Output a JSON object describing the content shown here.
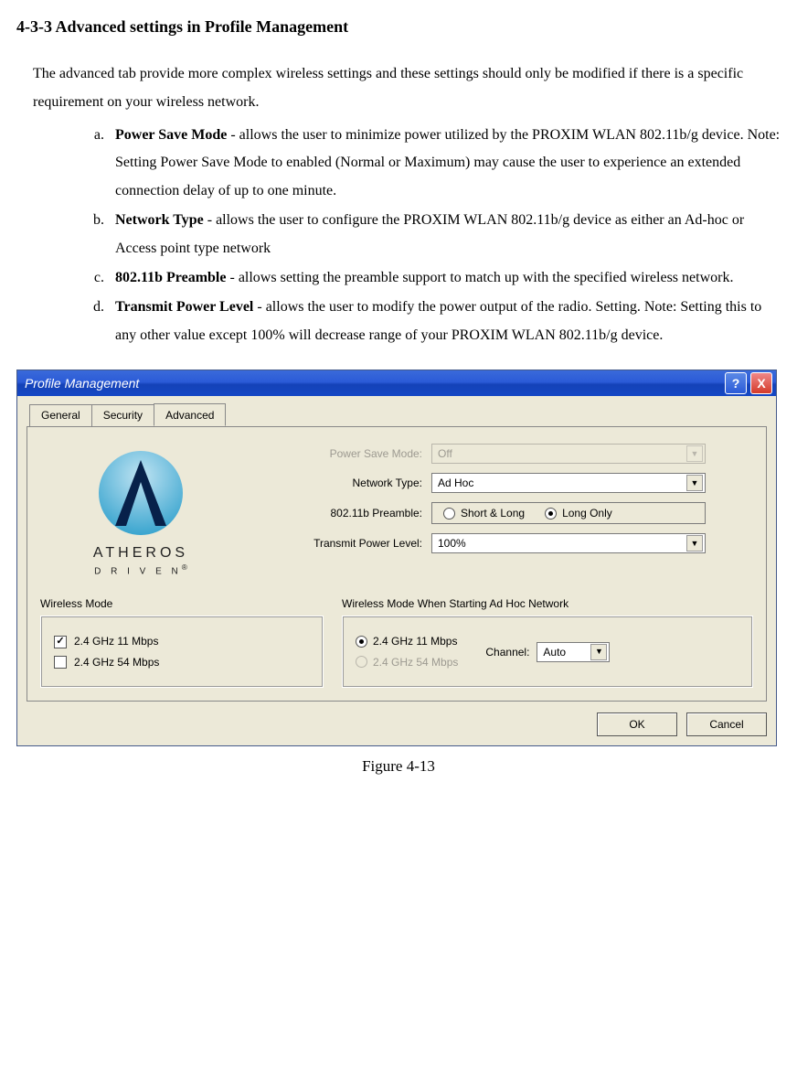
{
  "heading": "4-3-3 Advanced settings in Profile Management",
  "intro": "The advanced tab provide more complex wireless settings and these settings should only be modified if there is a specific requirement on your wireless network.",
  "items": {
    "a": {
      "bold": "Power Save Mode",
      "rest": " - allows the user to minimize power utilized by the PROXIM WLAN 802.11b/g  device.  Note: Setting Power Save Mode to enabled (Normal or Maximum) may cause the user to experience an extended connection delay of up to one minute."
    },
    "b": {
      "bold": "Network Type",
      "rest": " - allows the user to configure the PROXIM WLAN 802.11b/g  device as either an Ad-hoc or Access point type network"
    },
    "c": {
      "bold": "802.11b Preamble",
      "rest": "  - allows setting the preamble support to match up with the specified wireless network."
    },
    "d": {
      "bold": "Transmit Power Level",
      "rest": " - allows the user to modify the power output of the radio. Setting.  Note: Setting this to any other value except 100% will decrease range of your PROXIM WLAN 802.11b/g  device."
    }
  },
  "window": {
    "title": "Profile Management",
    "help": "?",
    "close": "X",
    "tabs": {
      "general": "General",
      "security": "Security",
      "advanced": "Advanced"
    },
    "logo": {
      "line1": "ATHEROS",
      "line2": "D R I V E N"
    },
    "labels": {
      "power": "Power Save Mode:",
      "nettype": "Network Type:",
      "preamble": "802.11b Preamble:",
      "txpower": "Transmit Power Level:",
      "wmode": "Wireless Mode",
      "wmodeadhoc": "Wireless Mode When Starting Ad Hoc Network",
      "channel": "Channel:"
    },
    "values": {
      "power": "Off",
      "nettype": "Ad Hoc",
      "txpower": "100%",
      "preamble_short": "Short & Long",
      "preamble_long": "Long Only",
      "opt11": "2.4 GHz 11 Mbps",
      "opt54": "2.4 GHz 54 Mbps",
      "channel": "Auto"
    },
    "buttons": {
      "ok": "OK",
      "cancel": "Cancel"
    }
  },
  "caption": "Figure 4-13"
}
